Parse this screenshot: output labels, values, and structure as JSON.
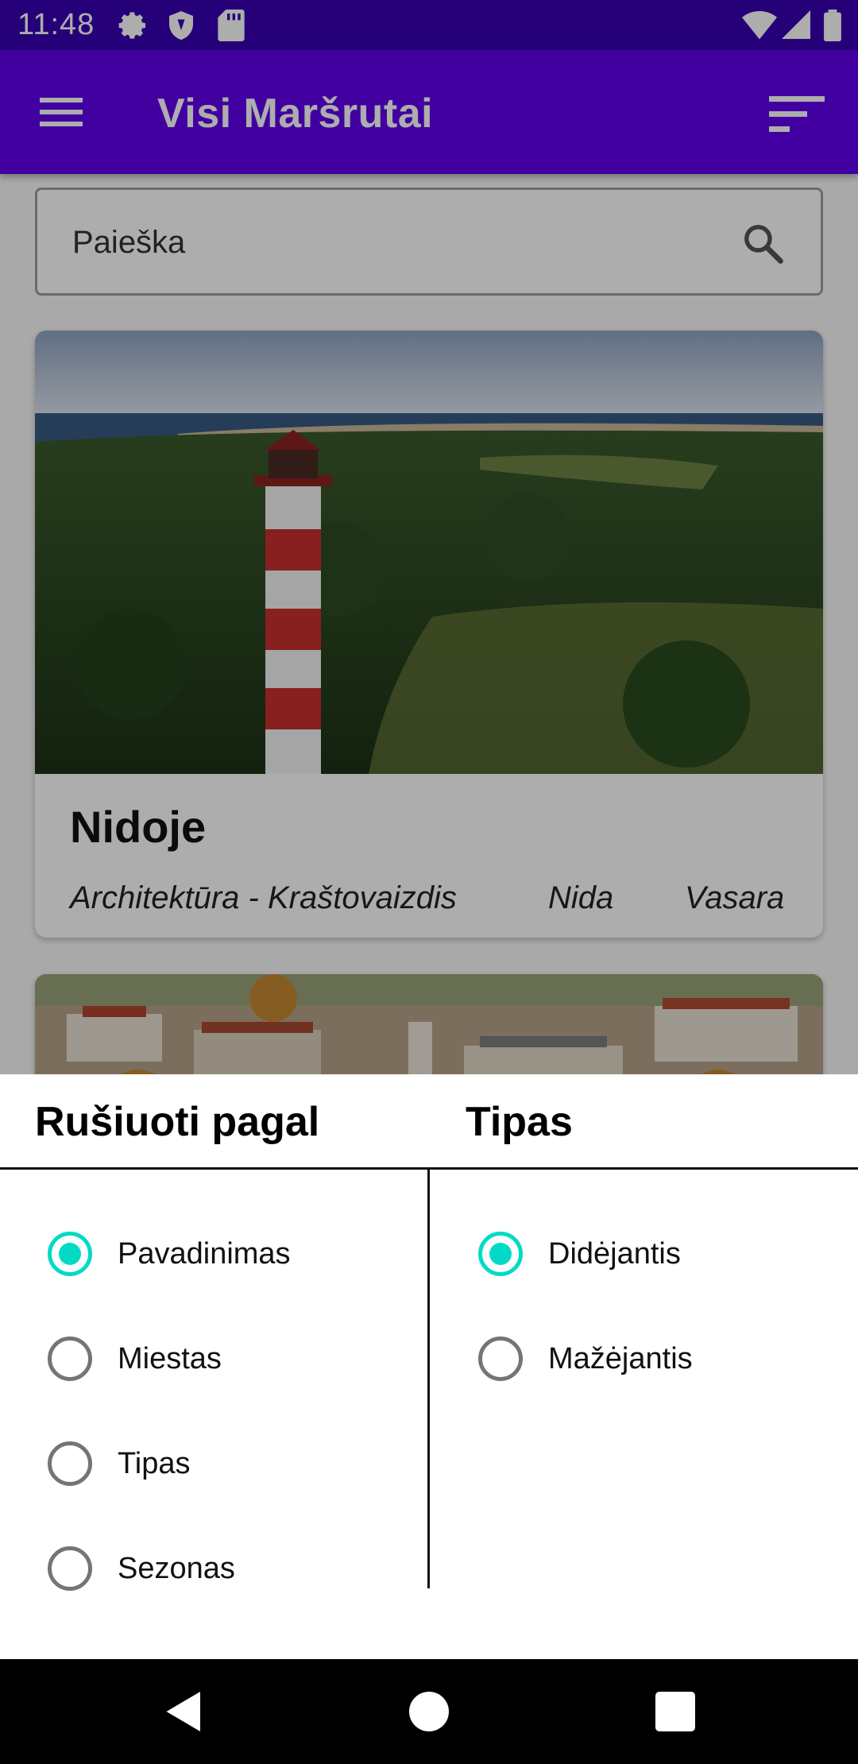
{
  "status_bar": {
    "time": "11:48",
    "icons": [
      "gear-icon",
      "shield-icon",
      "sd-card-icon",
      "wifi-icon",
      "signal-icon",
      "battery-icon"
    ]
  },
  "app_bar": {
    "title": "Visi Maršrutai",
    "menu_icon": "hamburger-menu-icon",
    "sort_icon": "sort-icon",
    "color": "#6200ee"
  },
  "search": {
    "placeholder": "Paieška",
    "icon": "search-icon"
  },
  "routes": [
    {
      "name": "Nidoje",
      "type": "Architektūra - Kraštovaizdis",
      "city": "Nida",
      "season": "Vasara"
    }
  ],
  "sort_sheet": {
    "sort_by_header": "Rušiuoti pagal",
    "order_header": "Tipas",
    "sort_by_options": [
      {
        "label": "Pavadinimas",
        "selected": true
      },
      {
        "label": "Miestas",
        "selected": false
      },
      {
        "label": "Tipas",
        "selected": false
      },
      {
        "label": "Sezonas",
        "selected": false
      }
    ],
    "order_options": [
      {
        "label": "Didėjantis",
        "selected": true
      },
      {
        "label": "Mažėjantis",
        "selected": false
      }
    ],
    "accent_color": "#03dac5"
  },
  "nav_bar": {
    "buttons": [
      "back-icon",
      "home-icon",
      "recents-icon"
    ]
  }
}
